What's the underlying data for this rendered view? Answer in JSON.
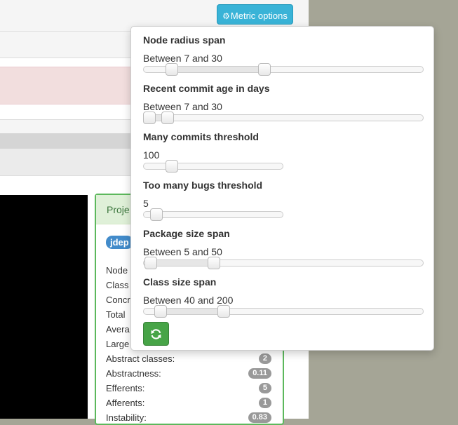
{
  "toolbar": {
    "metric_options_label": "Metric options",
    "icon": "gear-icon"
  },
  "project": {
    "panel_title": "Proje",
    "label": "jdep",
    "metrics": [
      {
        "label": "Node",
        "badge": null
      },
      {
        "label": "Class",
        "badge": null
      },
      {
        "label": "Concr",
        "badge": null
      },
      {
        "label": "Total",
        "badge": null
      },
      {
        "label": "Avera",
        "badge": null
      },
      {
        "label": "Large",
        "badge": null
      },
      {
        "label": "Abstract classes:",
        "badge": "2"
      },
      {
        "label": "Abstractness:",
        "badge": "0.11"
      },
      {
        "label": "Efferents:",
        "badge": "5"
      },
      {
        "label": "Afferents:",
        "badge": "1"
      },
      {
        "label": "Instability:",
        "badge": "0.83"
      }
    ]
  },
  "metric_options": {
    "node_radius": {
      "title": "Node radius span",
      "value_text": "Between 7 and 30",
      "range": [
        0.1,
        0.43
      ]
    },
    "commit_age": {
      "title": "Recent commit age in days",
      "value_text": "Between 7 and 30",
      "range": [
        0.02,
        0.085
      ]
    },
    "many_commits": {
      "title": "Many commits threshold",
      "value_text": "100",
      "position": 0.2
    },
    "bugs": {
      "title": "Too many bugs threshold",
      "value_text": "5",
      "position": 0.09
    },
    "package_size": {
      "title": "Package size span",
      "value_text": "Between 5 and 50",
      "range": [
        0.025,
        0.25
      ]
    },
    "class_size": {
      "title": "Class size span",
      "value_text": "Between 40 and 200",
      "range": [
        0.06,
        0.285
      ]
    },
    "refresh_icon": "refresh-icon"
  }
}
